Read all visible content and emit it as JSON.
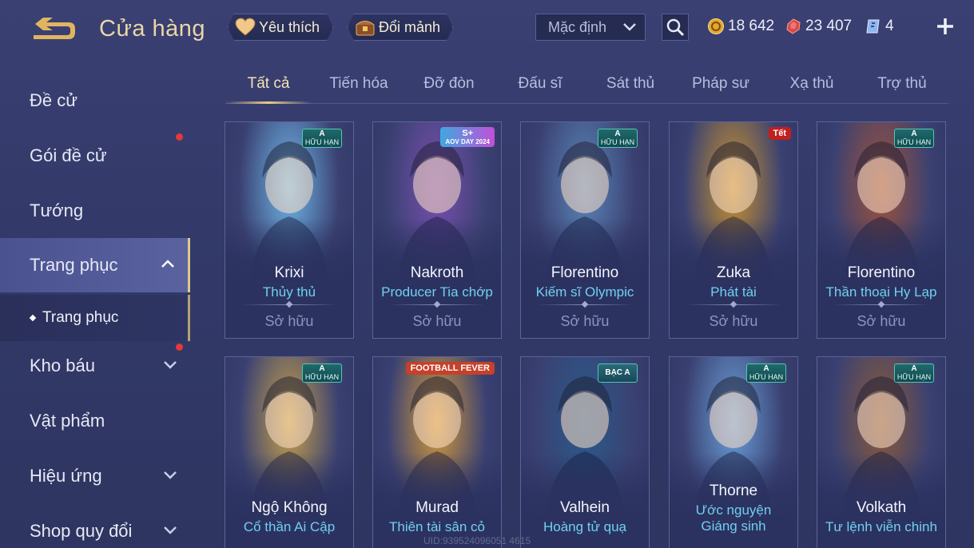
{
  "header": {
    "title": "Cửa hàng",
    "favorite_label": "Yêu thích",
    "shard_label": "Đổi mảnh",
    "sort_value": "Mặc định"
  },
  "currencies": {
    "gold": "18 642",
    "ruby": "23 407",
    "voucher": "4"
  },
  "sidebar": {
    "items": [
      {
        "label": "Đề cử"
      },
      {
        "label": "Gói đề cử"
      },
      {
        "label": "Tướng"
      },
      {
        "label": "Trang phục"
      },
      {
        "label": "Kho báu"
      },
      {
        "label": "Vật phẩm"
      },
      {
        "label": "Hiệu ứng"
      },
      {
        "label": "Shop quy đổi"
      }
    ],
    "sub_item": "Trang phục"
  },
  "tabs": [
    "Tất cả",
    "Tiến hóa",
    "Đỡ đòn",
    "Đấu sĩ",
    "Sát thủ",
    "Pháp sư",
    "Xạ thủ",
    "Trợ thủ"
  ],
  "cards": [
    {
      "hero": "Krixi",
      "skin": "Thủy thủ",
      "status": "Sở hữu",
      "badge": "A",
      "badge_sub": "HỮU HẠN",
      "accent": "#6fb7e8"
    },
    {
      "hero": "Nakroth",
      "skin": "Producer Tia chớp",
      "status": "Sở hữu",
      "event": "S+",
      "event_sub": "AOV DAY 2024",
      "accent": "#7a4fb0"
    },
    {
      "hero": "Florentino",
      "skin": "Kiếm sĩ Olympic",
      "status": "Sở hữu",
      "badge": "A",
      "badge_sub": "HỮU HẠN",
      "accent": "#5b85b8"
    },
    {
      "hero": "Zuka",
      "skin": "Phát tài",
      "status": "Sở hữu",
      "event": "Tết",
      "accent": "#c8922e"
    },
    {
      "hero": "Florentino",
      "skin": "Thần thoại Hy Lạp",
      "status": "Sở hữu",
      "badge": "A",
      "badge_sub": "HỮU HẠN",
      "accent": "#a0523a"
    },
    {
      "hero": "Ngộ Không",
      "skin": "Cổ thần Ai Cập",
      "badge": "A",
      "badge_sub": "HỮU HẠN",
      "accent": "#c7a14a"
    },
    {
      "hero": "Murad",
      "skin": "Thiên tài sân cỏ",
      "event": "FOOTBALL FEVER",
      "accent": "#d59a3a"
    },
    {
      "hero": "Valhein",
      "skin": "Hoàng tử quạ",
      "badge": "BẠC A",
      "accent": "#2a5a8a"
    },
    {
      "hero": "Thorne",
      "skin": "Ước nguyện Giáng sinh",
      "badge": "A",
      "badge_sub": "HỮU HẠN",
      "accent": "#6a9fd8"
    },
    {
      "hero": "Volkath",
      "skin": "Tư lệnh viễn chinh",
      "badge": "A",
      "badge_sub": "HỮU HẠN",
      "accent": "#8a5a3a"
    }
  ],
  "watermark": "UID:939524096051 4615"
}
